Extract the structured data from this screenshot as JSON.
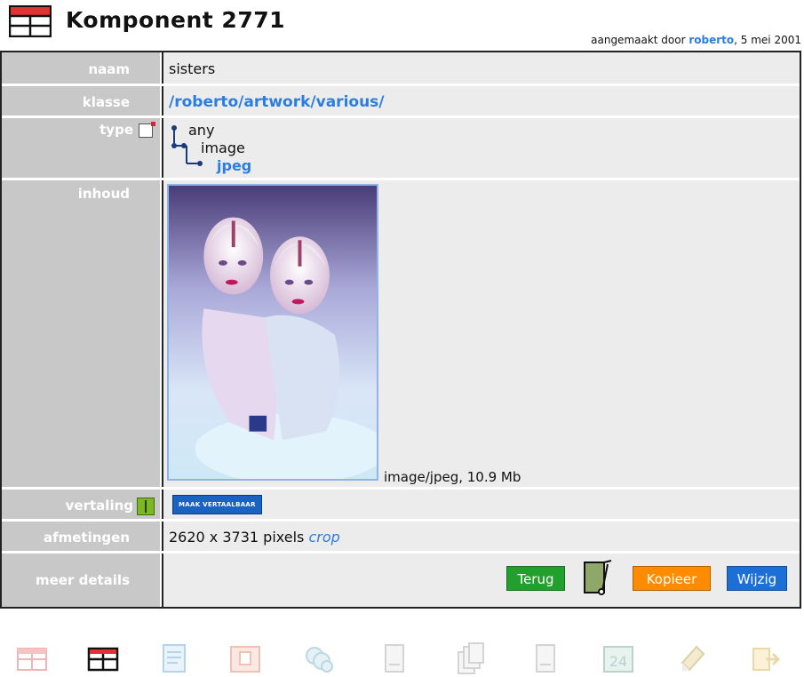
{
  "header": {
    "title": "Komponent 2771",
    "meta_prefix": "aangemaakt door ",
    "author": "roberto",
    "meta_suffix": ", 5 mei 2001"
  },
  "rows": {
    "naam": {
      "label": "naam",
      "value": "sisters"
    },
    "klasse": {
      "label": "klasse",
      "value": "/roberto/artwork/various/"
    },
    "type": {
      "label": "type",
      "tree": [
        "any",
        "image",
        "jpeg"
      ]
    },
    "inhoud": {
      "label": "inhoud",
      "caption": "image/jpeg, 10.9 Mb"
    },
    "vertaling": {
      "label": "vertaling",
      "button": "MAAK VERTAALBAAR"
    },
    "afmetingen": {
      "label": "afmetingen",
      "value": "2620 x 3731 pixels ",
      "link": "crop"
    },
    "meer": {
      "label": "meer details"
    }
  },
  "actions": {
    "terug": "Terug",
    "kopieer": "Kopieer",
    "wijzig": "Wijzig"
  },
  "toolbar": [
    "table-light-icon",
    "table-active-icon",
    "document-icon",
    "image-icon",
    "disks-icon",
    "page-blank-icon",
    "copy-pages-icon",
    "page-icon",
    "calendar-24-icon",
    "pencil-icon",
    "exit-icon"
  ],
  "colors": {
    "link": "#2b7de0",
    "label_bg": "#c8c8c8",
    "value_bg": "#ececec",
    "terug": "#22a02e",
    "kopieer": "#ff8c00",
    "wijzig": "#1c6fd6"
  }
}
